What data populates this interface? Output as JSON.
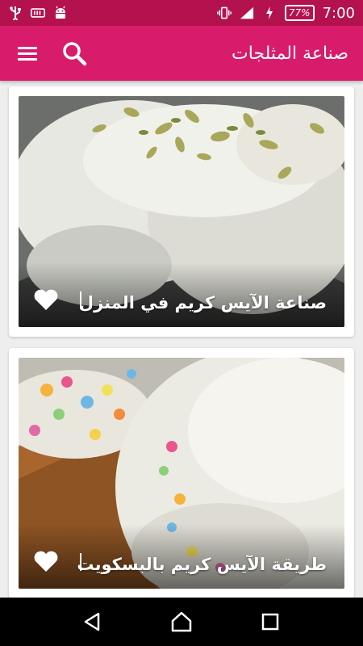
{
  "status_bar": {
    "battery": "77%",
    "time": "7:00"
  },
  "app_bar": {
    "title": "صناعة المثلجات"
  },
  "cards": [
    {
      "title": "صناعة الآيس كريم في المنزل"
    },
    {
      "title": "طريقة الآيس كريم بالبسكويت"
    }
  ],
  "colors": {
    "primary": "#d81b6a",
    "primary_dark": "#b4114f"
  }
}
